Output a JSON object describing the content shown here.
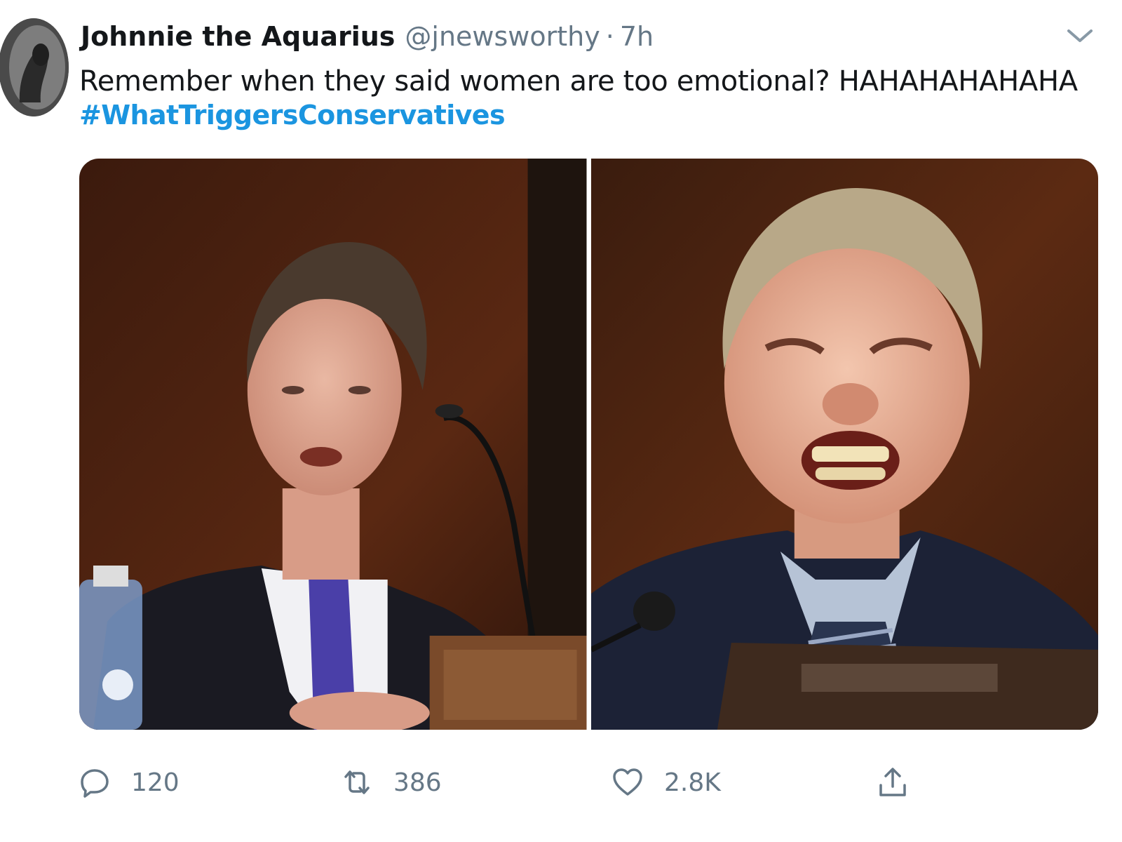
{
  "tweet": {
    "author": {
      "display_name": "Johnnie the Aquarius",
      "handle": "@jnewsworthy",
      "separator": "·",
      "time": "7h"
    },
    "text": "Remember when they said women are too emotional? HAHAHAHAHAHA",
    "hashtag": "#WhatTriggersConservatives",
    "media_count": 2
  },
  "actions": {
    "reply_count": "120",
    "retweet_count": "386",
    "like_count": "2.8K"
  },
  "icons": {
    "menu": "chevron-down-icon",
    "reply": "reply-icon",
    "retweet": "retweet-icon",
    "like": "heart-icon",
    "share": "share-icon"
  },
  "colors": {
    "text": "#14171a",
    "secondary": "#657786",
    "link": "#1b95e0"
  }
}
